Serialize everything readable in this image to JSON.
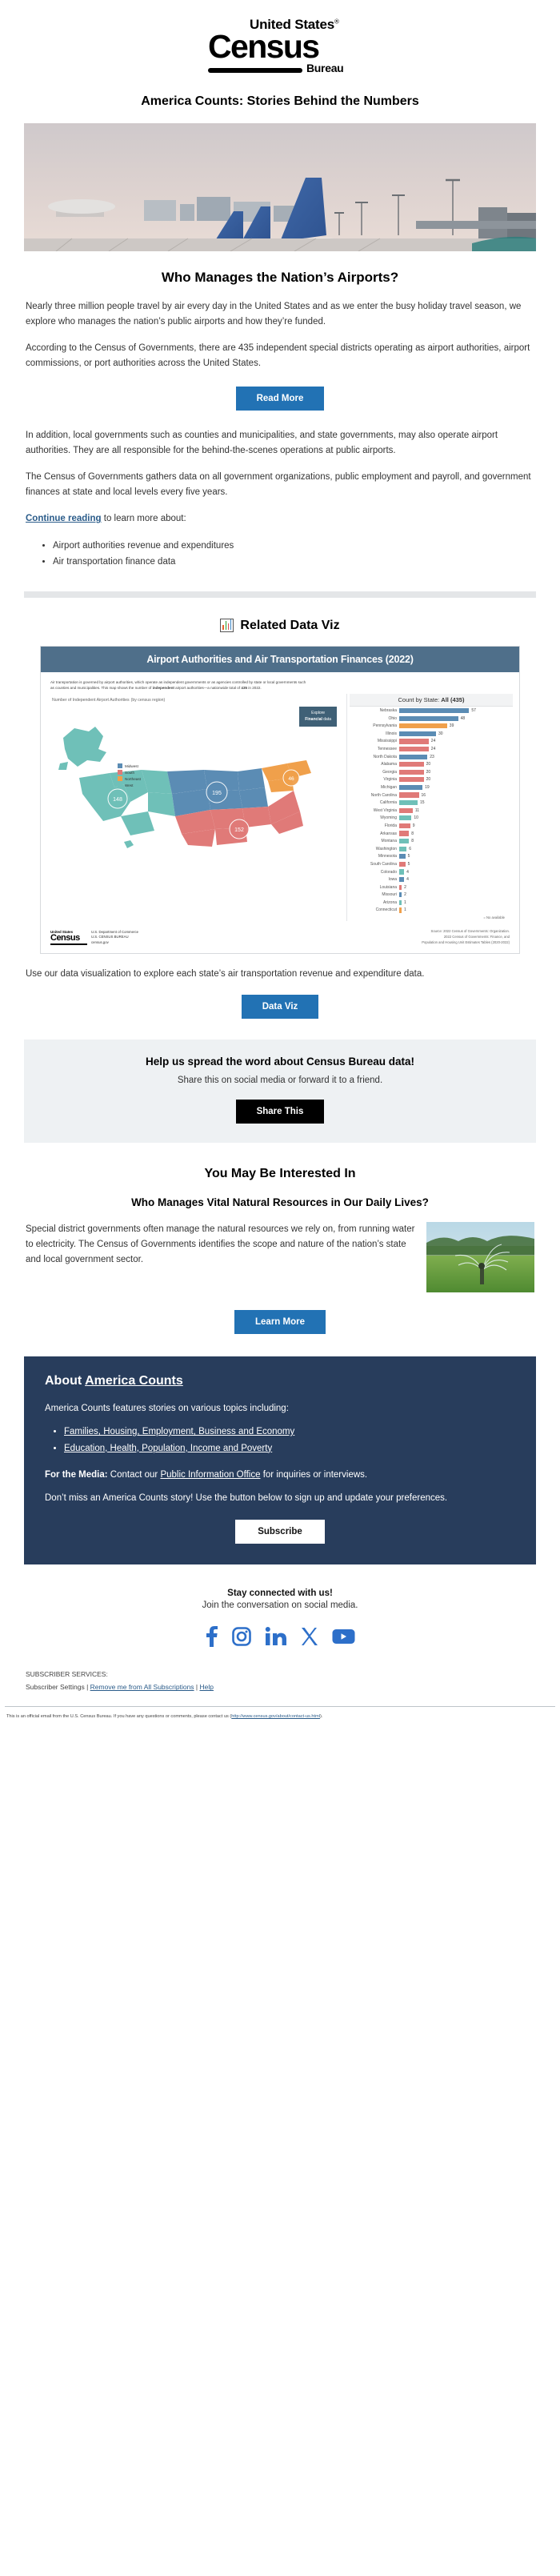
{
  "brand": {
    "united_states": "United States",
    "registered": "®",
    "census": "Census",
    "bureau": "Bureau"
  },
  "masthead": {
    "title": "America Counts: Stories Behind the Numbers"
  },
  "hero": {
    "alt": "airplane-tails-at-airport-terminal"
  },
  "article": {
    "heading": "Who Manages the Nation’s Airports?",
    "p1": "Nearly three million people travel by air every day in the United States and as we enter the busy holiday travel season, we explore who manages the nation’s public airports and how they’re funded.",
    "p2": "According to the Census of Governments, there are 435 independent special districts operating as airport authorities, airport commissions, or port authorities across the United States.",
    "read_more": "Read More",
    "p3": "In addition, local governments such as counties and municipalities, and state governments, may also operate airport authorities. They are all responsible for the behind-the-scenes operations at public airports.",
    "p4": "The Census of Governments gathers data on all government organizations, public employment and payroll, and government finances at state and local levels every five years.",
    "continue_link": "Continue reading",
    "continue_rest": " to learn more about:",
    "bullets": [
      "Airport authorities revenue and expenditures",
      "Air transportation finance data"
    ]
  },
  "data_viz": {
    "section_title": "Related Data Viz",
    "card_title": "Airport Authorities and Air Transportation Finances (2022)",
    "note_a": "Air transportation is governed by airport authorities, which operate as independent governments or as agencies controlled by state or local governments such",
    "note_b_pre": "as counties and municipalities. This map shows the number of ",
    "note_b_bold": "independent",
    "note_b_mid": " airport authorities—a nationwide total of ",
    "note_b_count": "435",
    "note_b_post": " in 2022.",
    "map_title": "Number of Independent Airport Authorities",
    "map_title_sub": "(by census region)",
    "explore_line1": "Explore",
    "explore_line2_bold": "Financial",
    "explore_line2_rest": " data",
    "legend": [
      {
        "label": "Midwest",
        "color": "#5b8cb4"
      },
      {
        "label": "South",
        "color": "#e07a78"
      },
      {
        "label": "Northeast",
        "color": "#f0a04b"
      },
      {
        "label": "West",
        "color": "#6fc0b8"
      }
    ],
    "region_markers": [
      {
        "label": "148",
        "color": "#6fc0b8"
      },
      {
        "label": "195",
        "color": "#5b8cb4"
      },
      {
        "label": "46",
        "color": "#f0a04b"
      },
      {
        "label": "152",
        "color": "#e07a78"
      }
    ],
    "no_data_label": "= No available",
    "caption": "Use our data visualization to explore each state’s air transportation revenue and expenditure data.",
    "button": "Data Viz",
    "org_us": "United States",
    "org_census": "Census",
    "org_bureau": "Bureau",
    "dept": "U.S. Department of Commerce\nU.S. CENSUS BUREAU\ncensus.gov",
    "source_1": "Source: 2022 Census of Governments: Organization.",
    "source_2": "2022 Census of Governments: Finance, and",
    "source_3": "Population and Housing Unit Estimates Tables (2020-2022)"
  },
  "chart_data": {
    "type": "bar",
    "title": "Count by State:",
    "title_bold": "All (435)",
    "xlabel": "",
    "ylabel": "State",
    "orientation": "horizontal",
    "colors": {
      "midwest": "#5b8cb4",
      "south": "#e07a78",
      "northeast": "#f0a04b",
      "west": "#6fc0b8"
    },
    "categories": [
      "Nebraska",
      "Ohio",
      "Pennsylvania",
      "Illinois",
      "Mississippi",
      "Tennessee",
      "North Dakota",
      "Alabama",
      "Georgia",
      "Virginia",
      "Michigan",
      "North Carolina",
      "California",
      "West Virginia",
      "Wyoming",
      "Florida",
      "Arkansas",
      "Montana",
      "Washington",
      "Minnesota",
      "South Carolina",
      "Colorado",
      "Iowa",
      "Louisiana",
      "Missouri",
      "Arizona",
      "Connecticut"
    ],
    "values": [
      57,
      48,
      39,
      30,
      24,
      24,
      23,
      20,
      20,
      20,
      19,
      16,
      15,
      11,
      10,
      9,
      8,
      8,
      6,
      5,
      5,
      4,
      4,
      2,
      2,
      1,
      1
    ],
    "regions": [
      "midwest",
      "midwest",
      "northeast",
      "midwest",
      "south",
      "south",
      "midwest",
      "south",
      "south",
      "south",
      "midwest",
      "south",
      "west",
      "south",
      "west",
      "south",
      "south",
      "west",
      "west",
      "midwest",
      "south",
      "west",
      "midwest",
      "south",
      "midwest",
      "west",
      "northeast"
    ],
    "total": 435,
    "xlim": [
      0,
      60
    ]
  },
  "share": {
    "title": "Help us spread the word about Census Bureau data!",
    "subtitle": "Share this on social media or forward it to a friend.",
    "button": "Share This"
  },
  "interest": {
    "section_title": "You May Be Interested In",
    "heading": "Who Manages Vital Natural Resources in Our Daily Lives?",
    "text": "Special district governments often manage the natural resources we rely on, from running water to electricity. The Census of Governments identifies the scope and nature of the nation’s state and local government sector.",
    "button": "Learn More",
    "image_alt": "sprinkler-watering-green-field"
  },
  "about": {
    "title_pre": "About ",
    "title_link": "America Counts",
    "intro": "America Counts features stories on various topics including:",
    "topics": [
      "Families, Housing, Employment, Business and Economy",
      "Education, Health, Population, Income and Poverty"
    ],
    "media_label": "For the Media:",
    "media_pre": " Contact our ",
    "media_link": "Public Information Office",
    "media_post": " for inquiries or interviews.",
    "cta": "Don’t miss an America Counts story! Use the button below to sign up and update your preferences.",
    "button": "Subscribe"
  },
  "connected": {
    "title": "Stay connected with us!",
    "subtitle": "Join the conversation on social media.",
    "socials": [
      "facebook-icon",
      "instagram-icon",
      "linkedin-icon",
      "x-twitter-icon",
      "youtube-icon"
    ]
  },
  "footer": {
    "services_label": "SUBSCRIBER SERVICES:",
    "settings": "Subscriber Settings",
    "sep1": "  |  ",
    "remove": "Remove me from All Subscriptions",
    "sep2": "  |  ",
    "help": "Help",
    "fine_pre": "This is an official email from the U.S. Census Bureau. If you have any questions or comments, please contact us (",
    "fine_link": "http://www.census.gov/about/contact-us.html",
    "fine_post": ")."
  }
}
